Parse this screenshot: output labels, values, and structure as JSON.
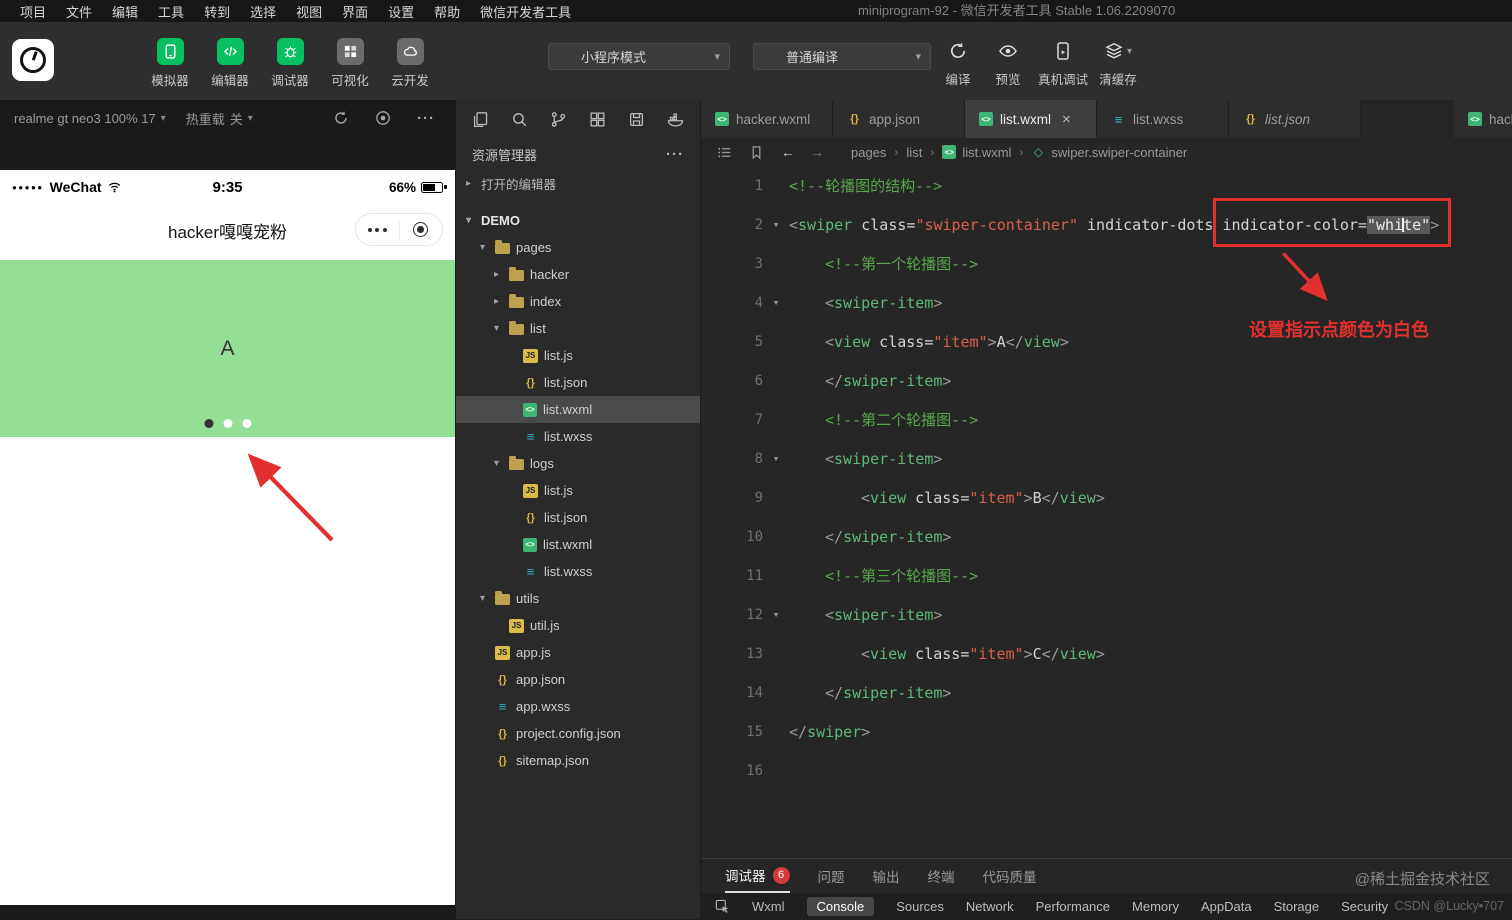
{
  "window": {
    "title": "miniprogram-92 - 微信开发者工具 Stable 1.06.2209070"
  },
  "menubar": {
    "items": [
      "项目",
      "文件",
      "编辑",
      "工具",
      "转到",
      "选择",
      "视图",
      "界面",
      "设置",
      "帮助",
      "微信开发者工具"
    ]
  },
  "toolbar": {
    "left_buttons": [
      {
        "label": "模拟器",
        "icon": "simulator-phone",
        "color": "green"
      },
      {
        "label": "编辑器",
        "icon": "editor-code",
        "color": "green"
      },
      {
        "label": "调试器",
        "icon": "debugger-bug",
        "color": "green"
      },
      {
        "label": "可视化",
        "icon": "visualization-grid",
        "color": "gray"
      },
      {
        "label": "云开发",
        "icon": "cloud-dev",
        "color": "gray"
      }
    ],
    "mode_select": {
      "value": "小程序模式"
    },
    "compile_select": {
      "value": "普通编译"
    },
    "right_buttons": [
      {
        "label": "编译",
        "icon": "compile-refresh"
      },
      {
        "label": "预览",
        "icon": "preview-eye"
      },
      {
        "label": "真机调试",
        "icon": "device-debug"
      },
      {
        "label": "清缓存",
        "icon": "clear-cache-layers",
        "has_dropdown": true
      }
    ]
  },
  "simulator": {
    "device_bar": {
      "device": "realme gt neo3 100% 17",
      "hot_reload_label": "热重载",
      "hot_reload_state": "关"
    },
    "status_bar": {
      "signal_dots": "●●●●●",
      "carrier": "WeChat",
      "time": "9:35",
      "battery": "66%"
    },
    "nav_title": "hacker嘎嘎宠粉",
    "swiper": {
      "item_label": "A",
      "dots": 3,
      "active_dot": 1,
      "bg": "#94de96"
    }
  },
  "explorer": {
    "title": "资源管理器",
    "top_icons": [
      "files",
      "search",
      "git-branch",
      "extensions",
      "save-all",
      "docker"
    ],
    "tree": [
      {
        "label": "打开的编辑器",
        "type": "section",
        "depth": 0,
        "chevron": "right"
      },
      {
        "label": "DEMO",
        "type": "root",
        "depth": 0,
        "chevron": "down"
      },
      {
        "label": "pages",
        "type": "folder",
        "depth": 1,
        "chevron": "down"
      },
      {
        "label": "hacker",
        "type": "folder",
        "depth": 2,
        "chevron": "right"
      },
      {
        "label": "index",
        "type": "folder",
        "depth": 2,
        "chevron": "right"
      },
      {
        "label": "list",
        "type": "folder",
        "depth": 2,
        "chevron": "down"
      },
      {
        "label": "list.js",
        "type": "js",
        "depth": 3
      },
      {
        "label": "list.json",
        "type": "json",
        "depth": 3
      },
      {
        "label": "list.wxml",
        "type": "wxml",
        "depth": 3,
        "selected": true
      },
      {
        "label": "list.wxss",
        "type": "wxss",
        "depth": 3
      },
      {
        "label": "logs",
        "type": "folder",
        "depth": 2,
        "chevron": "down"
      },
      {
        "label": "list.js",
        "type": "js",
        "depth": 3
      },
      {
        "label": "list.json",
        "type": "json",
        "depth": 3
      },
      {
        "label": "list.wxml",
        "type": "wxml",
        "depth": 3
      },
      {
        "label": "list.wxss",
        "type": "wxss",
        "depth": 3
      },
      {
        "label": "utils",
        "type": "folder",
        "depth": 1,
        "chevron": "down"
      },
      {
        "label": "util.js",
        "type": "js",
        "depth": 2
      },
      {
        "label": "app.js",
        "type": "js",
        "depth": 1
      },
      {
        "label": "app.json",
        "type": "json",
        "depth": 1
      },
      {
        "label": "app.wxss",
        "type": "wxss",
        "depth": 1
      },
      {
        "label": "project.config.json",
        "type": "json",
        "depth": 1
      },
      {
        "label": "sitemap.json",
        "type": "json",
        "depth": 1
      }
    ]
  },
  "tabs": [
    {
      "label": "hacker.wxml",
      "icon": "wxml"
    },
    {
      "label": "app.json",
      "icon": "json"
    },
    {
      "label": "list.wxml",
      "icon": "wxml",
      "active": true,
      "close": "×"
    },
    {
      "label": "list.wxss",
      "icon": "wxss"
    },
    {
      "label": "list.json",
      "icon": "json",
      "italic": true
    },
    {
      "label": "hacke",
      "icon": "wxml",
      "last": true
    }
  ],
  "breadcrumb": {
    "items": [
      {
        "label": "pages"
      },
      {
        "label": "list"
      },
      {
        "label": "list.wxml",
        "icon": "wxml"
      },
      {
        "label": "swiper.swiper-container",
        "icon": "node"
      }
    ]
  },
  "code": {
    "lines": [
      {
        "n": 1,
        "indent": 0,
        "fold": false,
        "tokens": [
          {
            "t": "com",
            "v": "<!--轮播图的结构-->"
          }
        ]
      },
      {
        "n": 2,
        "indent": 0,
        "fold": true,
        "tokens": [
          {
            "t": "pun",
            "v": "<"
          },
          {
            "t": "tag",
            "v": "swiper"
          },
          {
            "t": "attr",
            "v": " class="
          },
          {
            "t": "str",
            "v": "\"swiper-container\""
          },
          {
            "t": "attr",
            "v": " indicator-dots indicator-color="
          },
          {
            "t": "sel",
            "v": "\"white\""
          },
          {
            "t": "pun",
            "v": ">"
          }
        ]
      },
      {
        "n": 3,
        "indent": 1,
        "fold": false,
        "tokens": [
          {
            "t": "com",
            "v": "<!--第一个轮播图-->"
          }
        ]
      },
      {
        "n": 4,
        "indent": 1,
        "fold": true,
        "tokens": [
          {
            "t": "pun",
            "v": "<"
          },
          {
            "t": "tag",
            "v": "swiper-item"
          },
          {
            "t": "pun",
            "v": ">"
          }
        ]
      },
      {
        "n": 5,
        "indent": 1,
        "fold": false,
        "tokens": [
          {
            "t": "pun",
            "v": "<"
          },
          {
            "t": "tag",
            "v": "view"
          },
          {
            "t": "attr",
            "v": " class="
          },
          {
            "t": "str",
            "v": "\"item\""
          },
          {
            "t": "pun",
            "v": ">"
          },
          {
            "t": "txt",
            "v": "A"
          },
          {
            "t": "pun",
            "v": "</"
          },
          {
            "t": "tag",
            "v": "view"
          },
          {
            "t": "pun",
            "v": ">"
          }
        ]
      },
      {
        "n": 6,
        "indent": 1,
        "fold": false,
        "tokens": [
          {
            "t": "pun",
            "v": "</"
          },
          {
            "t": "tag",
            "v": "swiper-item"
          },
          {
            "t": "pun",
            "v": ">"
          }
        ]
      },
      {
        "n": 7,
        "indent": 1,
        "fold": false,
        "tokens": [
          {
            "t": "com",
            "v": "<!--第二个轮播图-->"
          }
        ]
      },
      {
        "n": 8,
        "indent": 1,
        "fold": true,
        "tokens": [
          {
            "t": "pun",
            "v": "<"
          },
          {
            "t": "tag",
            "v": "swiper-item"
          },
          {
            "t": "pun",
            "v": ">"
          }
        ]
      },
      {
        "n": 9,
        "indent": 2,
        "fold": false,
        "tokens": [
          {
            "t": "pun",
            "v": "<"
          },
          {
            "t": "tag",
            "v": "view"
          },
          {
            "t": "attr",
            "v": " class="
          },
          {
            "t": "str",
            "v": "\"item\""
          },
          {
            "t": "pun",
            "v": ">"
          },
          {
            "t": "txt",
            "v": "B"
          },
          {
            "t": "pun",
            "v": "</"
          },
          {
            "t": "tag",
            "v": "view"
          },
          {
            "t": "pun",
            "v": ">"
          }
        ]
      },
      {
        "n": 10,
        "indent": 1,
        "fold": false,
        "tokens": [
          {
            "t": "pun",
            "v": "</"
          },
          {
            "t": "tag",
            "v": "swiper-item"
          },
          {
            "t": "pun",
            "v": ">"
          }
        ]
      },
      {
        "n": 11,
        "indent": 1,
        "fold": false,
        "tokens": [
          {
            "t": "com",
            "v": "<!--第三个轮播图-->"
          }
        ]
      },
      {
        "n": 12,
        "indent": 1,
        "fold": true,
        "tokens": [
          {
            "t": "pun",
            "v": "<"
          },
          {
            "t": "tag",
            "v": "swiper-item"
          },
          {
            "t": "pun",
            "v": ">"
          }
        ]
      },
      {
        "n": 13,
        "indent": 2,
        "fold": false,
        "tokens": [
          {
            "t": "pun",
            "v": "<"
          },
          {
            "t": "tag",
            "v": "view"
          },
          {
            "t": "attr",
            "v": " class="
          },
          {
            "t": "str",
            "v": "\"item\""
          },
          {
            "t": "pun",
            "v": ">"
          },
          {
            "t": "txt",
            "v": "C"
          },
          {
            "t": "pun",
            "v": "</"
          },
          {
            "t": "tag",
            "v": "view"
          },
          {
            "t": "pun",
            "v": ">"
          }
        ]
      },
      {
        "n": 14,
        "indent": 1,
        "fold": false,
        "tokens": [
          {
            "t": "pun",
            "v": "</"
          },
          {
            "t": "tag",
            "v": "swiper-item"
          },
          {
            "t": "pun",
            "v": ">"
          }
        ]
      },
      {
        "n": 15,
        "indent": 0,
        "fold": false,
        "tokens": [
          {
            "t": "pun",
            "v": "</"
          },
          {
            "t": "tag",
            "v": "swiper"
          },
          {
            "t": "pun",
            "v": ">"
          }
        ]
      },
      {
        "n": 16,
        "indent": 0,
        "fold": false,
        "tokens": []
      }
    ]
  },
  "annotations": {
    "note": "设置指示点颜色为白色",
    "accent_color": "#e2302e"
  },
  "bottom": {
    "panel_tabs": [
      {
        "label": "调试器",
        "badge": "6",
        "active": true
      },
      {
        "label": "问题"
      },
      {
        "label": "输出"
      },
      {
        "label": "终端"
      },
      {
        "label": "代码质量"
      }
    ],
    "debug_tabs": [
      {
        "label": "Wxml"
      },
      {
        "label": "Console",
        "active": true
      },
      {
        "label": "Sources"
      },
      {
        "label": "Network"
      },
      {
        "label": "Performance"
      },
      {
        "label": "Memory"
      },
      {
        "label": "AppData"
      },
      {
        "label": "Storage"
      },
      {
        "label": "Security"
      }
    ],
    "watermark1": "@稀土掘金技术社区",
    "watermark2": "CSDN @Lucky•707"
  }
}
